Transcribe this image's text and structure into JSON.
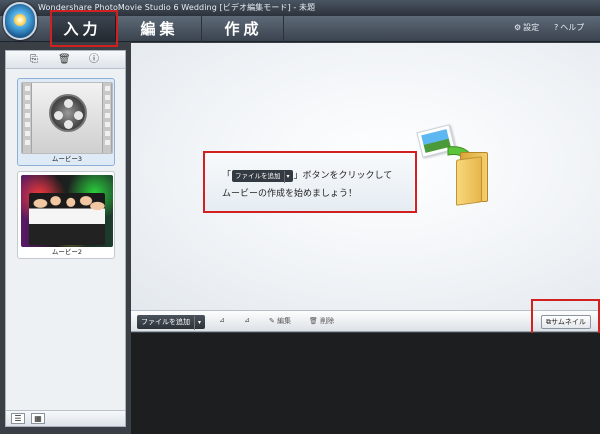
{
  "window": {
    "title": "Wondershare PhotoMovie Studio 6 Wedding [ビデオ編集モード] - 未題"
  },
  "tabs": [
    {
      "label": "入力"
    },
    {
      "label": "編集"
    },
    {
      "label": "作成"
    }
  ],
  "header": {
    "settings_label": "設定",
    "help_label": "ヘルプ"
  },
  "library": {
    "items": [
      {
        "caption": "ムービー3"
      },
      {
        "caption": "ムービー2"
      }
    ]
  },
  "preview": {
    "open_bracket": "「",
    "button_label": "ファイルを追加",
    "line1_rest": "」ボタンをクリックして",
    "line2": "ムービーの作成を始めましょう！"
  },
  "timeline_toolbar": {
    "add_file_label": "ファイルを追加",
    "edit_label": "編集",
    "delete_label": "削除",
    "thumbnail_label": "サムネイル"
  },
  "colors": {
    "accent_red": "#d21f1f",
    "tabbar": "#3a434e",
    "timeline_bg": "#1d1e1f"
  }
}
